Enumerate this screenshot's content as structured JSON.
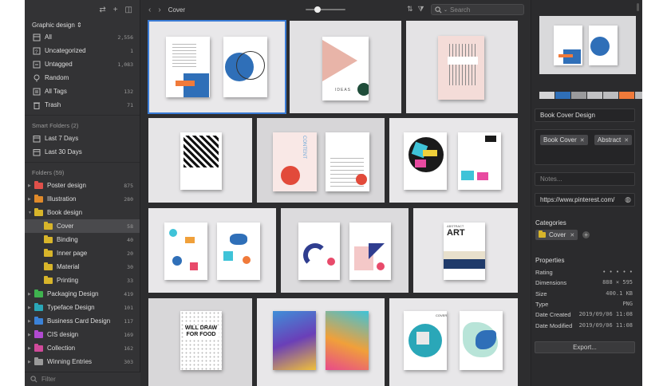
{
  "sidebar": {
    "library_name": "Graphic design ⇕",
    "library_items": [
      {
        "label": "All",
        "count": "2,556",
        "icon": "all-icon"
      },
      {
        "label": "Uncategorized",
        "count": "1",
        "icon": "uncategorized-icon"
      },
      {
        "label": "Untagged",
        "count": "1,083",
        "icon": "untagged-icon"
      },
      {
        "label": "Random",
        "count": "",
        "icon": "random-icon"
      },
      {
        "label": "All Tags",
        "count": "132",
        "icon": "tags-icon"
      },
      {
        "label": "Trash",
        "count": "71",
        "icon": "trash-icon"
      }
    ],
    "smart_folders_title": "Smart Folders (2)",
    "smart_folders": [
      {
        "label": "Last 7 Days",
        "icon": "calendar-icon"
      },
      {
        "label": "Last 30 Days",
        "icon": "calendar-icon"
      }
    ],
    "folders_title": "Folders (59)",
    "folders": [
      {
        "label": "Poster design",
        "count": "875",
        "color": "#e0504a"
      },
      {
        "label": "Illustration",
        "count": "280",
        "color": "#e08a2a"
      },
      {
        "label": "Book design",
        "count": "",
        "color": "#d8b52a"
      },
      {
        "label": "Packaging Design",
        "count": "419",
        "color": "#3fb34f"
      },
      {
        "label": "Typeface Design",
        "count": "101",
        "color": "#2aa7b8"
      },
      {
        "label": "Business Card Design",
        "count": "117",
        "color": "#3b82d8"
      },
      {
        "label": "CIS design",
        "count": "169",
        "color": "#b04ad0"
      },
      {
        "label": "Collection",
        "count": "162",
        "color": "#d04a9a"
      },
      {
        "label": "Winning Entries",
        "count": "303",
        "color": "#9a9a9a"
      }
    ],
    "subfolders": [
      {
        "label": "Cover",
        "count": "58"
      },
      {
        "label": "Binding",
        "count": "40"
      },
      {
        "label": "Inner page",
        "count": "20"
      },
      {
        "label": "Material",
        "count": "30"
      },
      {
        "label": "Printing",
        "count": "33"
      }
    ],
    "filter_placeholder": "Filter"
  },
  "toolbar": {
    "title": "Cover",
    "search_placeholder": "Search"
  },
  "inspector": {
    "swatches": [
      "#d4d4d6",
      "#2f6fb8",
      "#9a9a9c",
      "#c2c2c4",
      "#bdbdbf",
      "#f07a3a",
      "#b8b8ba"
    ],
    "name": "Book Cover Design",
    "tags": [
      "Book Cover",
      "Abstract"
    ],
    "notes_placeholder": "Notes...",
    "url": "https://www.pinterest.com/",
    "categories_title": "Categories",
    "category": "Cover",
    "properties_title": "Properties",
    "properties": [
      {
        "label": "Rating",
        "value": "• • • • •"
      },
      {
        "label": "Dimensions",
        "value": "888 × 595"
      },
      {
        "label": "Size",
        "value": "400.1 KB"
      },
      {
        "label": "Type",
        "value": "PNG"
      },
      {
        "label": "Date Created",
        "value": "2019/09/06 11:08"
      },
      {
        "label": "Date Modified",
        "value": "2019/09/06 11:08"
      }
    ],
    "export_label": "Export..."
  },
  "thumb_texts": {
    "ideas": "IDEAS",
    "content": "CONTENT",
    "art_top": "ABSTRACT",
    "art": "ART",
    "cover": "COVER",
    "will_draw": "WILL DRAW FOR FOOD"
  }
}
